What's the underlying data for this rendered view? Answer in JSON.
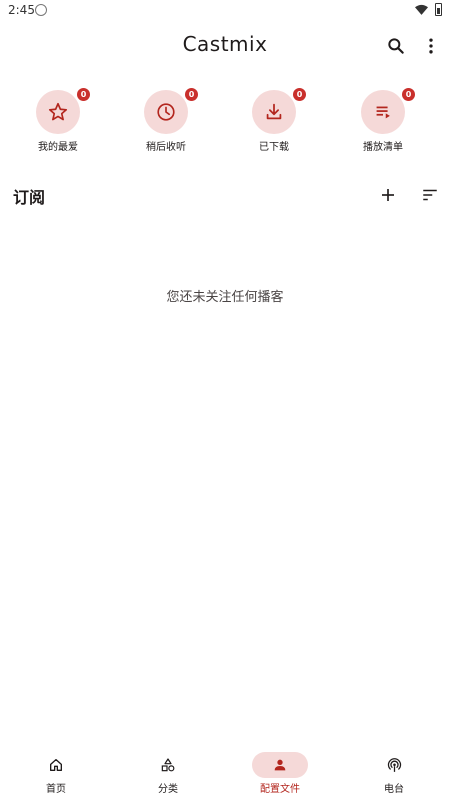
{
  "status_bar": {
    "time": "2:45"
  },
  "app_bar": {
    "title": "Castmix",
    "search_icon": "search-icon",
    "more_icon": "more-vert-icon"
  },
  "shortcuts": [
    {
      "label": "我的最爱",
      "icon": "star-icon",
      "badge": "0"
    },
    {
      "label": "稍后收听",
      "icon": "clock-icon",
      "badge": "0"
    },
    {
      "label": "已下载",
      "icon": "download-icon",
      "badge": "0"
    },
    {
      "label": "播放清单",
      "icon": "playlist-icon",
      "badge": "0"
    }
  ],
  "subscriptions": {
    "title": "订阅",
    "empty_message": "您还未关注任何播客"
  },
  "bottom_nav": [
    {
      "label": "首页",
      "icon": "home-icon",
      "active": false
    },
    {
      "label": "分类",
      "icon": "category-icon",
      "active": false
    },
    {
      "label": "配置文件",
      "icon": "person-icon",
      "active": true
    },
    {
      "label": "电台",
      "icon": "podcast-icon",
      "active": false
    }
  ],
  "colors": {
    "accent": "#b3261e",
    "tonal": "#f5d9d8",
    "badge": "#c9302c"
  }
}
